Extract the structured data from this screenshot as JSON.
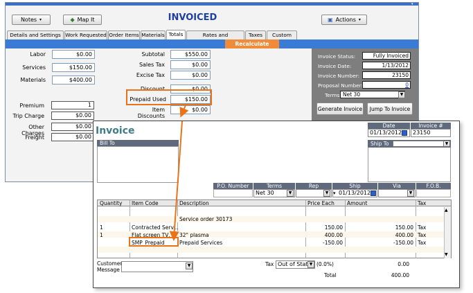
{
  "main": {
    "notes_label": "Notes",
    "map_label": "Map It",
    "status_title": "INVOICED",
    "actions_label": "Actions",
    "tabs": [
      "Details and Settings",
      "Work Requested",
      "Order Items",
      "Materials",
      "Totals",
      "Rates and Assignments",
      "Taxes",
      "Custom Tabs"
    ],
    "recalculate_label": "Recalculate",
    "left": {
      "labor_label": "Labor",
      "labor_value": "$0.00",
      "services_label": "Services",
      "services_value": "$150.00",
      "materials_label": "Materials",
      "materials_value": "$400.00",
      "premium_label": "Premium",
      "premium_value": "1",
      "trip_label": "Trip Charge",
      "trip_value": "$0.00",
      "other_label": "Other Charges",
      "other_value": "$0.00",
      "freight_label": "Freight",
      "freight_value": "$0.00"
    },
    "middle": {
      "subtotal_label": "Subtotal",
      "subtotal_value": "$550.00",
      "salestax_label": "Sales Tax",
      "salestax_value": "$0.00",
      "excise_label": "Excise Tax",
      "excise_value": "$0.00",
      "discount_label": "Discount",
      "discount_value": "$0.00",
      "prepaid_label": "Prepaid Used",
      "prepaid_value": "$150.00",
      "itemdisc_label": "Item Discounts",
      "itemdisc_value": "$0.00"
    },
    "right": {
      "status_label": "Invoice Status:",
      "status_value": "Fully Invoiced",
      "date_label": "Invoice Date:",
      "date_value": "1/13/2012",
      "number_label": "Invoice Number:",
      "number_value": "23150",
      "proposal_label": "Proposal Number:",
      "proposal_value": "0",
      "terms_label": "Terms",
      "terms_value": "Net 30",
      "generate_label": "Generate Invoice",
      "jump_label": "Jump To Invoice"
    }
  },
  "invoice": {
    "title": "Invoice",
    "date_header": "Date",
    "date_value": "01/13/2012",
    "number_header": "Invoice #",
    "number_value": "23150",
    "billto_label": "Bill To",
    "shipto_label": "Ship To",
    "po_header": "P.O. Number",
    "terms_header": "Terms",
    "terms_value": "Net 30",
    "rep_header": "Rep",
    "ship_header": "Ship",
    "ship_value": "01/13/2012",
    "via_header": "Via",
    "fob_header": "F.O.B.",
    "columns": [
      "Quantity",
      "Item Code",
      "Description",
      "Price Each",
      "Amount",
      "Tax"
    ],
    "rows": [
      {
        "qty": "",
        "code": "",
        "desc": "",
        "price": "",
        "amount": "",
        "tax": ""
      },
      {
        "qty": "",
        "code": "",
        "desc": "Service order 30173",
        "price": "",
        "amount": "",
        "tax": ""
      },
      {
        "qty": "1",
        "code": "Contracted Serv...",
        "desc": "",
        "price": "150.00",
        "amount": "150.00",
        "tax": "Tax"
      },
      {
        "qty": "1",
        "code": "Flat screen TV, ...",
        "desc": "32\" plasma",
        "price": "400.00",
        "amount": "400.00",
        "tax": "Tax"
      },
      {
        "qty": "",
        "code": "SMP_Prepaid",
        "desc": "Prepaid Services",
        "price": "-150.00",
        "amount": "-150.00",
        "tax": "Tax"
      }
    ],
    "customer_message_label": "Customer Message",
    "tax_label": "Tax",
    "tax_value": "Out of State",
    "tax_rate": "(0.0%)",
    "tax_amount": "0.00",
    "total_label": "Total",
    "total_value": "400.00"
  },
  "colors": {
    "accent_blue": "#3a7bd5",
    "recalc_orange": "#f08b3a",
    "highlight": "#e8731a",
    "panel_gray": "#7e7e7e"
  }
}
